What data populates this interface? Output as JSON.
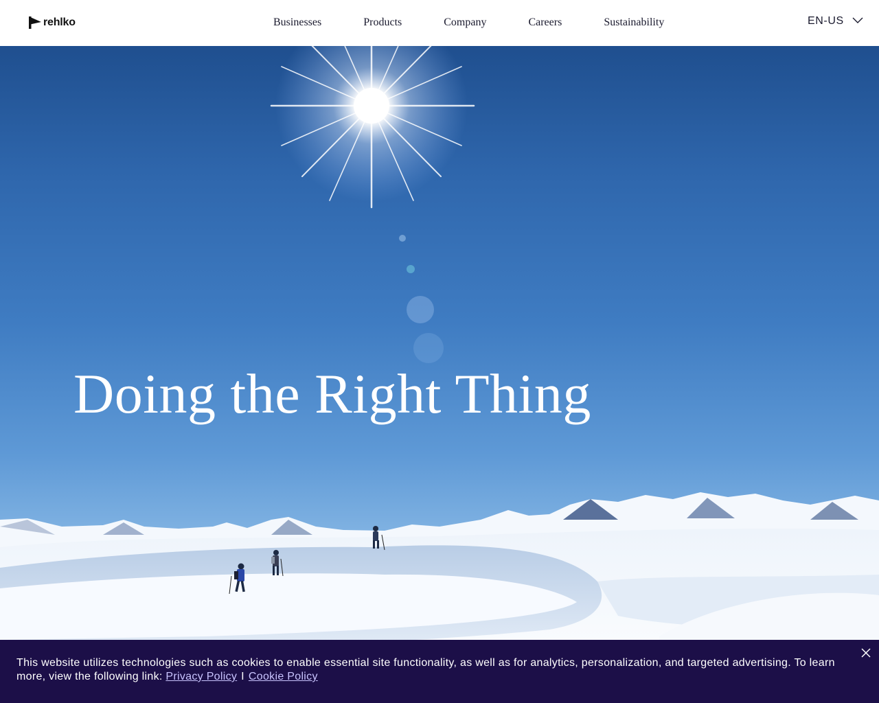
{
  "header": {
    "logo_text": "rehlko",
    "nav": [
      {
        "label": "Businesses"
      },
      {
        "label": "Products"
      },
      {
        "label": "Company"
      },
      {
        "label": "Careers"
      },
      {
        "label": "Sustainability"
      }
    ],
    "language": "EN-US"
  },
  "hero": {
    "title": "Doing the Right Thing"
  },
  "cookie_banner": {
    "text": "This website utilizes technologies such as cookies to enable essential site functionality, as well as for analytics, personalization, and targeted advertising. To learn more, view the following link:",
    "privacy_link": "Privacy Policy",
    "separator": "I",
    "cookie_link": "Cookie Policy"
  },
  "colors": {
    "banner_bg": "#1c0f48",
    "sky_top": "#1f4f8f",
    "text_dark": "#1a1a2e"
  },
  "icons": {
    "logo": "arrow-flag-icon",
    "language_dropdown": "chevron-down-icon",
    "close": "close-icon"
  }
}
